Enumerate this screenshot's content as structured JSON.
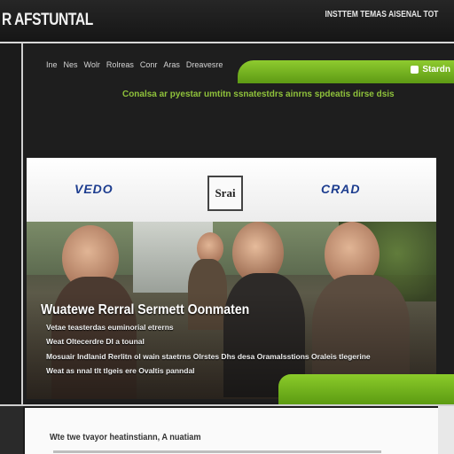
{
  "header": {
    "logo_text": "R AFSTUNTAL",
    "top_links": "INSTTEM TEMAS AISENAL  TOT"
  },
  "nav": {
    "items": [
      "Ine",
      "Nes",
      "Wolr",
      "Rolreas",
      "Conr",
      "Aras",
      "Dreavesre"
    ],
    "signin_label": "Stardn"
  },
  "tagline": "Conalsa ar pyestar umtitn ssnatestdrs ainrns spdeatis dirse dsis",
  "partners": {
    "left_logo": "VEDO",
    "center_seal": "Srai",
    "right_logo": "CRAD"
  },
  "hero": {
    "title": "Wuatewe Rerral Sermett Oonmaten",
    "lines": [
      "Vetae teasterdas euminorial etrerns",
      "Weat Oltecerdre DI a tounal",
      "Mosuair Indlanid Rerlitn ol wain staetrns Olrstes Dhs desa Oramalsstions Oraleis tlegerine",
      "Weat as nnal tlt tlgeis ere Ovaltis panndal"
    ]
  },
  "lower": {
    "title": "Wte twe tvayor heatinstiann, A nuatiam"
  }
}
